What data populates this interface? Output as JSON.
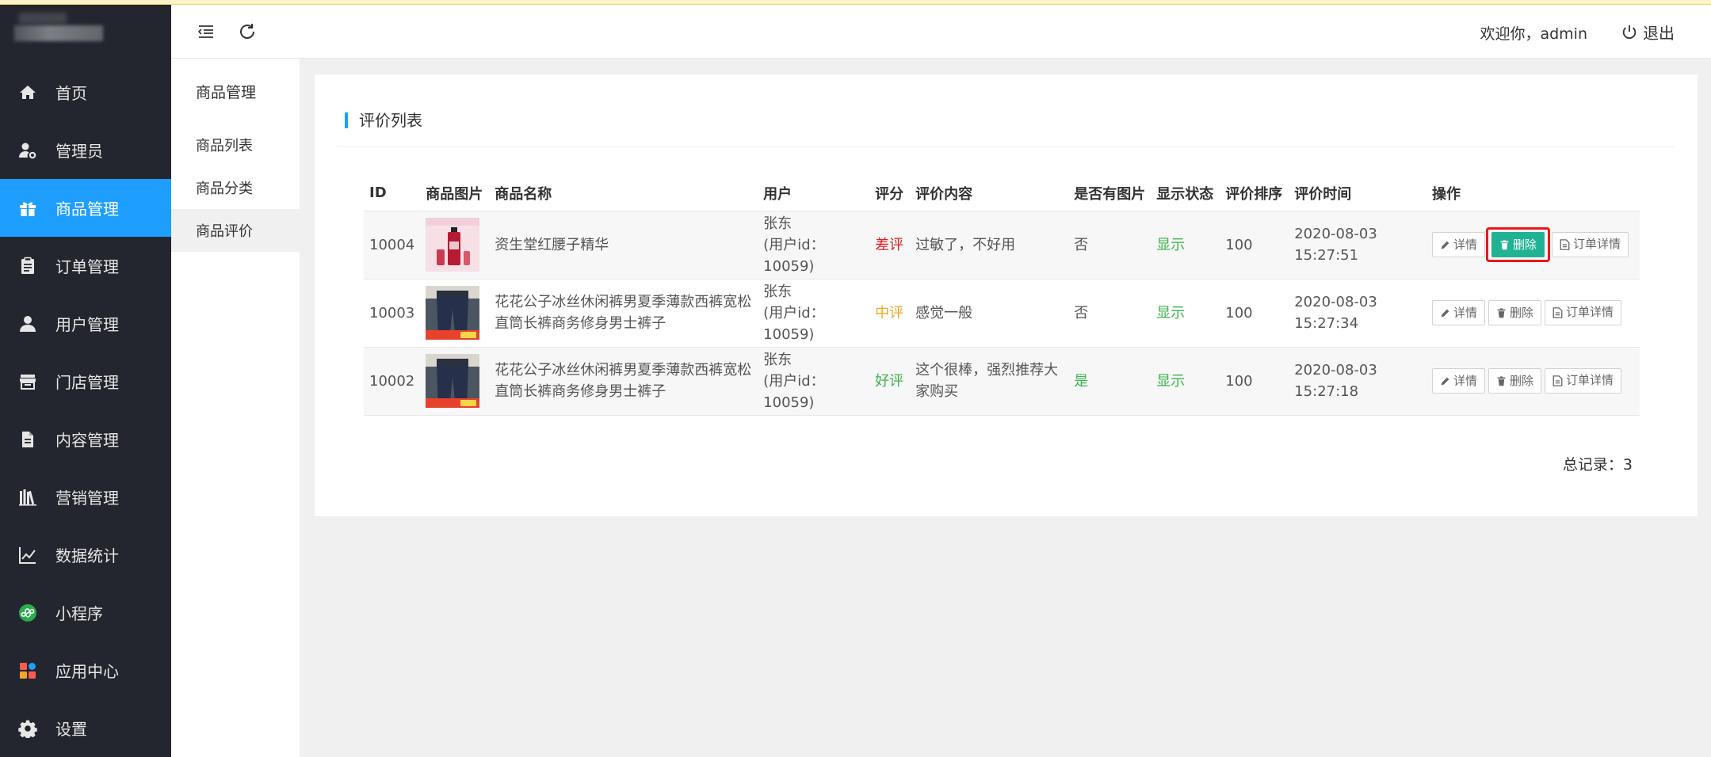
{
  "sidebar": {
    "items": [
      {
        "label": "首页",
        "icon": "home-icon"
      },
      {
        "label": "管理员",
        "icon": "admin-icon"
      },
      {
        "label": "商品管理",
        "icon": "gift-icon",
        "active": true
      },
      {
        "label": "订单管理",
        "icon": "clipboard-icon"
      },
      {
        "label": "用户管理",
        "icon": "user-icon"
      },
      {
        "label": "门店管理",
        "icon": "store-icon"
      },
      {
        "label": "内容管理",
        "icon": "document-icon"
      },
      {
        "label": "营销管理",
        "icon": "books-icon"
      },
      {
        "label": "数据统计",
        "icon": "chart-icon"
      },
      {
        "label": "小程序",
        "icon": "miniapp-icon"
      },
      {
        "label": "应用中心",
        "icon": "apps-icon"
      },
      {
        "label": "设置",
        "icon": "gear-icon"
      }
    ]
  },
  "header": {
    "welcome": "欢迎你，admin",
    "logout": "退出"
  },
  "subnav": {
    "title": "商品管理",
    "items": [
      {
        "label": "商品列表"
      },
      {
        "label": "商品分类"
      },
      {
        "label": "商品评价",
        "active": true
      }
    ]
  },
  "main": {
    "title": "评价列表",
    "columns": [
      "ID",
      "商品图片",
      "商品名称",
      "用户",
      "评分",
      "评价内容",
      "是否有图片",
      "显示状态",
      "评价排序",
      "评价时间",
      "操作"
    ],
    "rows": [
      {
        "id": "10004",
        "name": "资生堂红腰子精华",
        "user": "张东",
        "user_id": "(用户id：10059)",
        "rating": "差评",
        "content": "过敏了，不好用",
        "has_image": "否",
        "status": "显示",
        "sort": "100",
        "time": "2020-08-03 15:27:51"
      },
      {
        "id": "10003",
        "name": "花花公子冰丝休闲裤男夏季薄款西裤宽松直筒长裤商务修身男士裤子",
        "user": "张东",
        "user_id": "(用户id：10059)",
        "rating": "中评",
        "content": "感觉一般",
        "has_image": "否",
        "status": "显示",
        "sort": "100",
        "time": "2020-08-03 15:27:34"
      },
      {
        "id": "10002",
        "name": "花花公子冰丝休闲裤男夏季薄款西裤宽松直筒长裤商务修身男士裤子",
        "user": "张东",
        "user_id": "(用户id：10059)",
        "rating": "好评",
        "content": "这个很棒，强烈推荐大家购买",
        "has_image": "是",
        "status": "显示",
        "sort": "100",
        "time": "2020-08-03 15:27:18"
      }
    ],
    "actions": {
      "detail": "详情",
      "delete": "删除",
      "order_detail": "订单详情"
    },
    "total": "总记录：3"
  },
  "colors": {
    "accent": "#1e9fff",
    "sidebar_bg": "#23262e",
    "danger_btn": "#1fb394",
    "bad_rating": "#e02020",
    "mid_rating": "#f5a623",
    "good": "#39b54a"
  }
}
